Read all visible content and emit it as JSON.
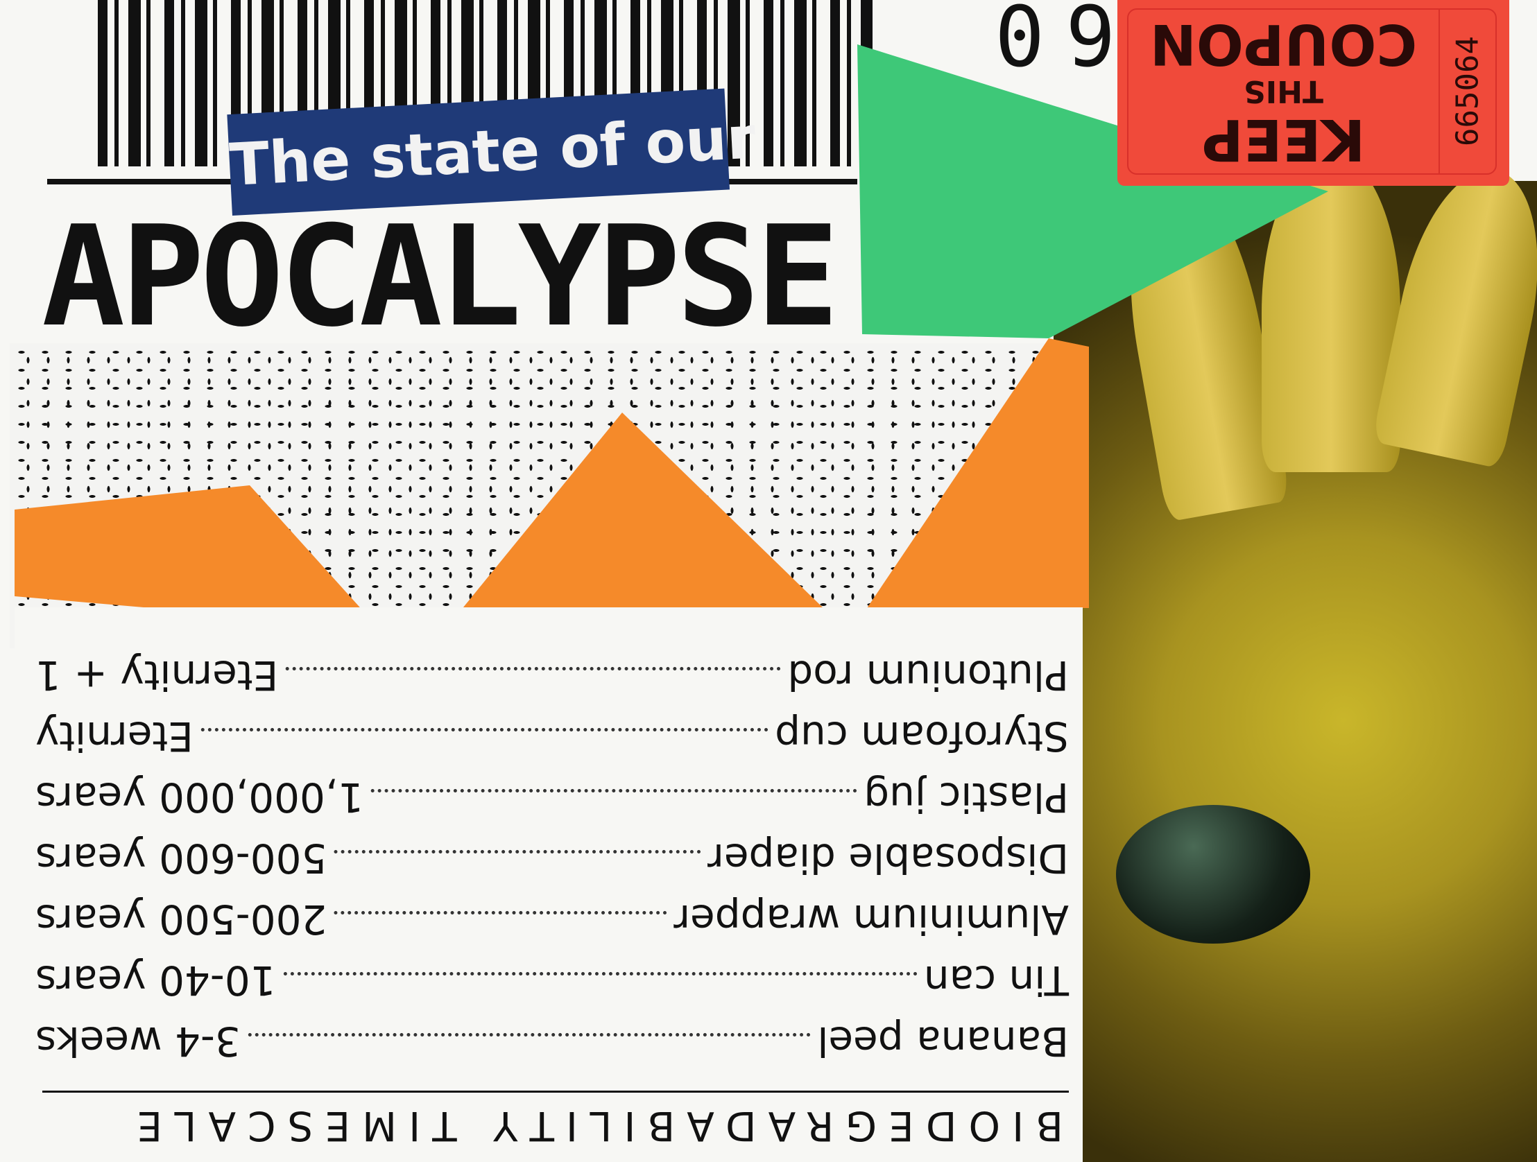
{
  "collage": {
    "barcode_number": "09",
    "subtitle": "The state of our",
    "title": "APOCALYPSE",
    "coupon": {
      "serial": "665064",
      "line1": "KEEP",
      "line2": "THIS",
      "line3": "COUPON"
    },
    "timescale": {
      "heading": "BIODEGRADABILITY TIMESCALE",
      "rows": [
        {
          "item": "Banana peel",
          "duration": "3-4 weeks"
        },
        {
          "item": "Tin can",
          "duration": "10-40 years"
        },
        {
          "item": "Aluminium wrapper",
          "duration": "200-500 years"
        },
        {
          "item": "Disposable diaper",
          "duration": "500-600 years"
        },
        {
          "item": "Plastic jug",
          "duration": "1,000,000 years"
        },
        {
          "item": "Styrofoam cup",
          "duration": "Eternity"
        },
        {
          "item": "Plutonium rod",
          "duration": "Eternity + 1"
        }
      ]
    },
    "colors": {
      "blue": "#1f3a78",
      "green": "#3ec878",
      "orange": "#f58a2a",
      "red": "#f04a3a",
      "yellow": "#c9b62a"
    }
  }
}
